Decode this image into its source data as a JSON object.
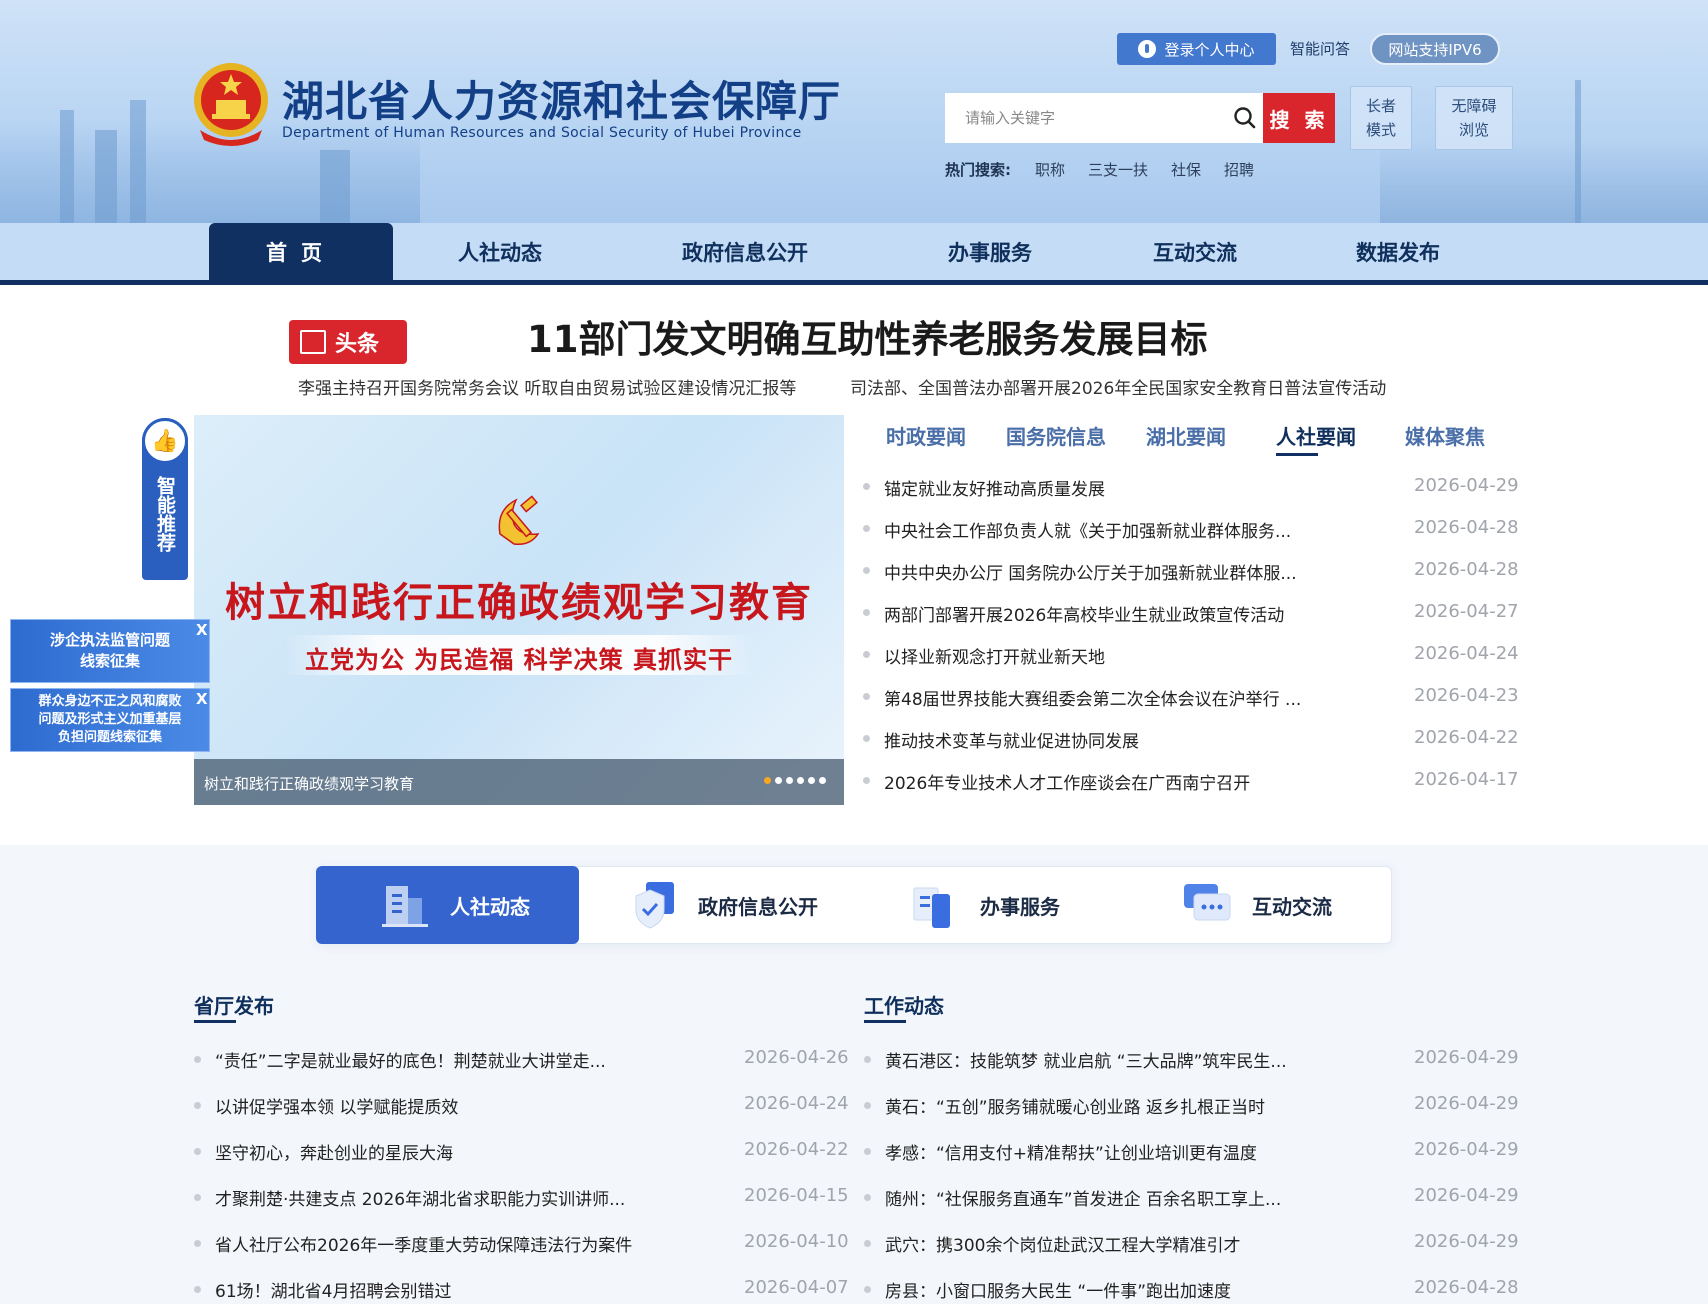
{
  "header": {
    "site_title": "湖北省人力资源和社会保障厅",
    "site_subtitle": "Department of Human Resources and Social Security of Hubei Province",
    "login_label": "登录个人中心",
    "qa_label": "智能问答",
    "ipv6_label": "网站支持IPV6",
    "search_placeholder": "请输入关键字",
    "search_button": "搜 索",
    "elder_mode": [
      "长者",
      "模式"
    ],
    "access_mode": [
      "无障碍",
      "浏览"
    ],
    "hot_label": "热门搜索:",
    "hot_items": [
      "职称",
      "三支一扶",
      "社保",
      "招聘"
    ]
  },
  "nav": {
    "items": [
      "首页",
      "人社动态",
      "政府信息公开",
      "办事服务",
      "互动交流",
      "数据发布"
    ]
  },
  "headline": {
    "badge": "头条",
    "title": "11部门发文明确互助性养老服务发展目标",
    "sub_links": [
      "李强主持召开国务院常务会议 听取自由贸易试验区建设情况汇报等",
      "司法部、全国普法办部署开展2026年全民国家安全教育日普法宣传活动"
    ]
  },
  "smart_recommend": {
    "label": "智能推荐"
  },
  "floating_banners": [
    {
      "text_lines": [
        "涉企执法监管问题",
        "线索征集"
      ],
      "close": "X"
    },
    {
      "text_lines": [
        "群众身边不正之风和腐败",
        "问题及形式主义加重基层",
        "负担问题线索征集"
      ],
      "close": "X"
    }
  ],
  "carousel": {
    "main_text": "树立和践行正确政绩观学习教育",
    "sub_text": "立党为公  为民造福  科学决策  真抓实干",
    "caption": "树立和践行正确政绩观学习教育",
    "dots": 6,
    "active_dot": 0
  },
  "news": {
    "tabs": [
      "时政要闻",
      "国务院信息",
      "湖北要闻",
      "人社要闻",
      "媒体聚焦"
    ],
    "active_tab": 3,
    "items": [
      {
        "title": "锚定就业友好推动高质量发展",
        "date": "2026-04-29"
      },
      {
        "title": "中央社会工作部负责人就《关于加强新就业群体服务...",
        "date": "2026-04-28"
      },
      {
        "title": "中共中央办公厅 国务院办公厅关于加强新就业群体服...",
        "date": "2026-04-28"
      },
      {
        "title": "两部门部署开展2026年高校毕业生就业政策宣传活动",
        "date": "2026-04-27"
      },
      {
        "title": "以择业新观念打开就业新天地",
        "date": "2026-04-24"
      },
      {
        "title": "第48届世界技能大赛组委会第二次全体会议在沪举行 ...",
        "date": "2026-04-23"
      },
      {
        "title": "推动技术变革与就业促进协同发展",
        "date": "2026-04-22"
      },
      {
        "title": "2026年专业技术人才工作座谈会在广西南宁召开",
        "date": "2026-04-17"
      }
    ]
  },
  "category_tabs": {
    "items": [
      "人社动态",
      "政府信息公开",
      "办事服务",
      "互动交流"
    ],
    "active": 0
  },
  "columns": {
    "left": {
      "title": "省厅发布",
      "items": [
        {
          "title": "“责任”二字是就业最好的底色！荆楚就业大讲堂走...",
          "date": "2026-04-26"
        },
        {
          "title": "以讲促学强本领 以学赋能提质效",
          "date": "2026-04-24"
        },
        {
          "title": "坚守初心，奔赴创业的星辰大海",
          "date": "2026-04-22"
        },
        {
          "title": "才聚荆楚·共建支点 2026年湖北省求职能力实训讲师...",
          "date": "2026-04-15"
        },
        {
          "title": "省人社厅公布2026年一季度重大劳动保障违法行为案件",
          "date": "2026-04-10"
        },
        {
          "title": "61场！湖北省4月招聘会别错过",
          "date": "2026-04-07"
        }
      ]
    },
    "right": {
      "title": "工作动态",
      "items": [
        {
          "title": "黄石港区：技能筑梦 就业启航 “三大品牌”筑牢民生...",
          "date": "2026-04-29"
        },
        {
          "title": "黄石：“五创”服务铺就暖心创业路 返乡扎根正当时",
          "date": "2026-04-29"
        },
        {
          "title": "孝感：“信用支付+精准帮扶”让创业培训更有温度",
          "date": "2026-04-29"
        },
        {
          "title": "随州：“社保服务直通车”首发进企 百余名职工享上...",
          "date": "2026-04-29"
        },
        {
          "title": "武穴：携300余个岗位赴武汉工程大学精准引才",
          "date": "2026-04-29"
        },
        {
          "title": "房县：小窗口服务大民生 “一件事”跑出加速度",
          "date": "2026-04-28"
        }
      ]
    }
  },
  "colors": {
    "brand_navy": "#0f3061",
    "accent_red": "#d9252c",
    "link_blue": "#3564cf"
  }
}
